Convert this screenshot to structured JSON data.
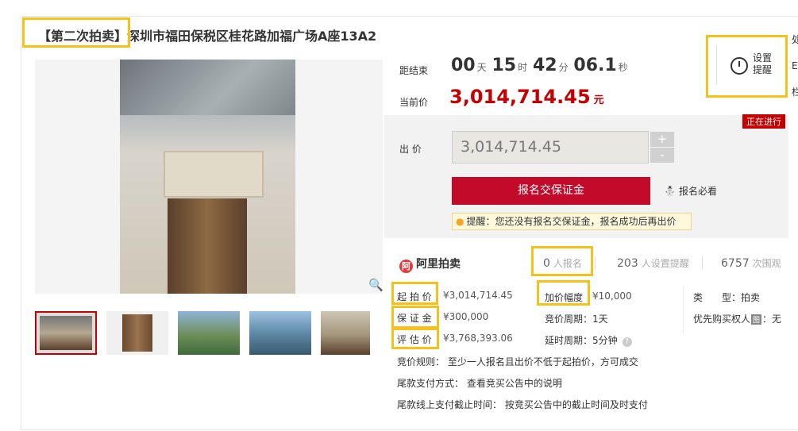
{
  "title": "【第二次拍卖】深圳市福田保税区桂花路加福广场A座13A2",
  "countdown": {
    "label": "距结束",
    "days": "00",
    "days_unit": "天",
    "hours": "15",
    "hours_unit": "时",
    "minutes": "42",
    "minutes_unit": "分",
    "seconds": "06.1",
    "seconds_unit": "秒"
  },
  "current_price": {
    "label": "当前价",
    "value": "3,014,714.45",
    "unit": "元"
  },
  "reminder": {
    "line1": "设置",
    "line2": "提醒"
  },
  "status_badge": "正在进行",
  "bid": {
    "label": "出 价",
    "value": "3,014,714.45",
    "plus": "+",
    "minus": "-",
    "signup_button": "报名交保证金",
    "must_read": "报名必看",
    "tip_prefix": "提醒：",
    "tip_text": "您还没有报名交保证金，报名成功后再出价"
  },
  "brand": {
    "mark": "阿",
    "name": "阿里拍卖"
  },
  "stats": [
    {
      "num": "0",
      "text": "人报名"
    },
    {
      "num": "203",
      "text": "人设置提醒"
    },
    {
      "num": "6757",
      "text": "次围观"
    }
  ],
  "details": {
    "start_price_label": "起 拍 价",
    "start_price": "¥3,014,714.45",
    "deposit_label": "保 证 金",
    "deposit": "¥300,000",
    "appraisal_label": "评 估 价",
    "appraisal": "¥3,768,393.06",
    "increment_label": "加价幅度",
    "increment": "¥10,000",
    "cycle_label": "竞价周期：",
    "cycle": "1天",
    "delay_label": "延时周期：",
    "delay": "5分钟",
    "help_icon": "?",
    "type_label": "类　　型：",
    "type": "拍卖",
    "priority_label": "优先购买权人",
    "priority_badge": "图",
    "priority_value": "：无"
  },
  "rules": [
    "竞价规则：  至少一人报名且出价不低于起拍价，方可成交",
    "尾款支付方式：  查看竞买公告中的说明",
    "尾款线上支付截止时间：  按竞买公告中的截止时间及时支付"
  ],
  "right_edge": [
    "处",
    "E",
    "栏"
  ],
  "colors": {
    "accent": "#c40000",
    "button": "#c40a2b",
    "highlight": "#f5c21b"
  }
}
